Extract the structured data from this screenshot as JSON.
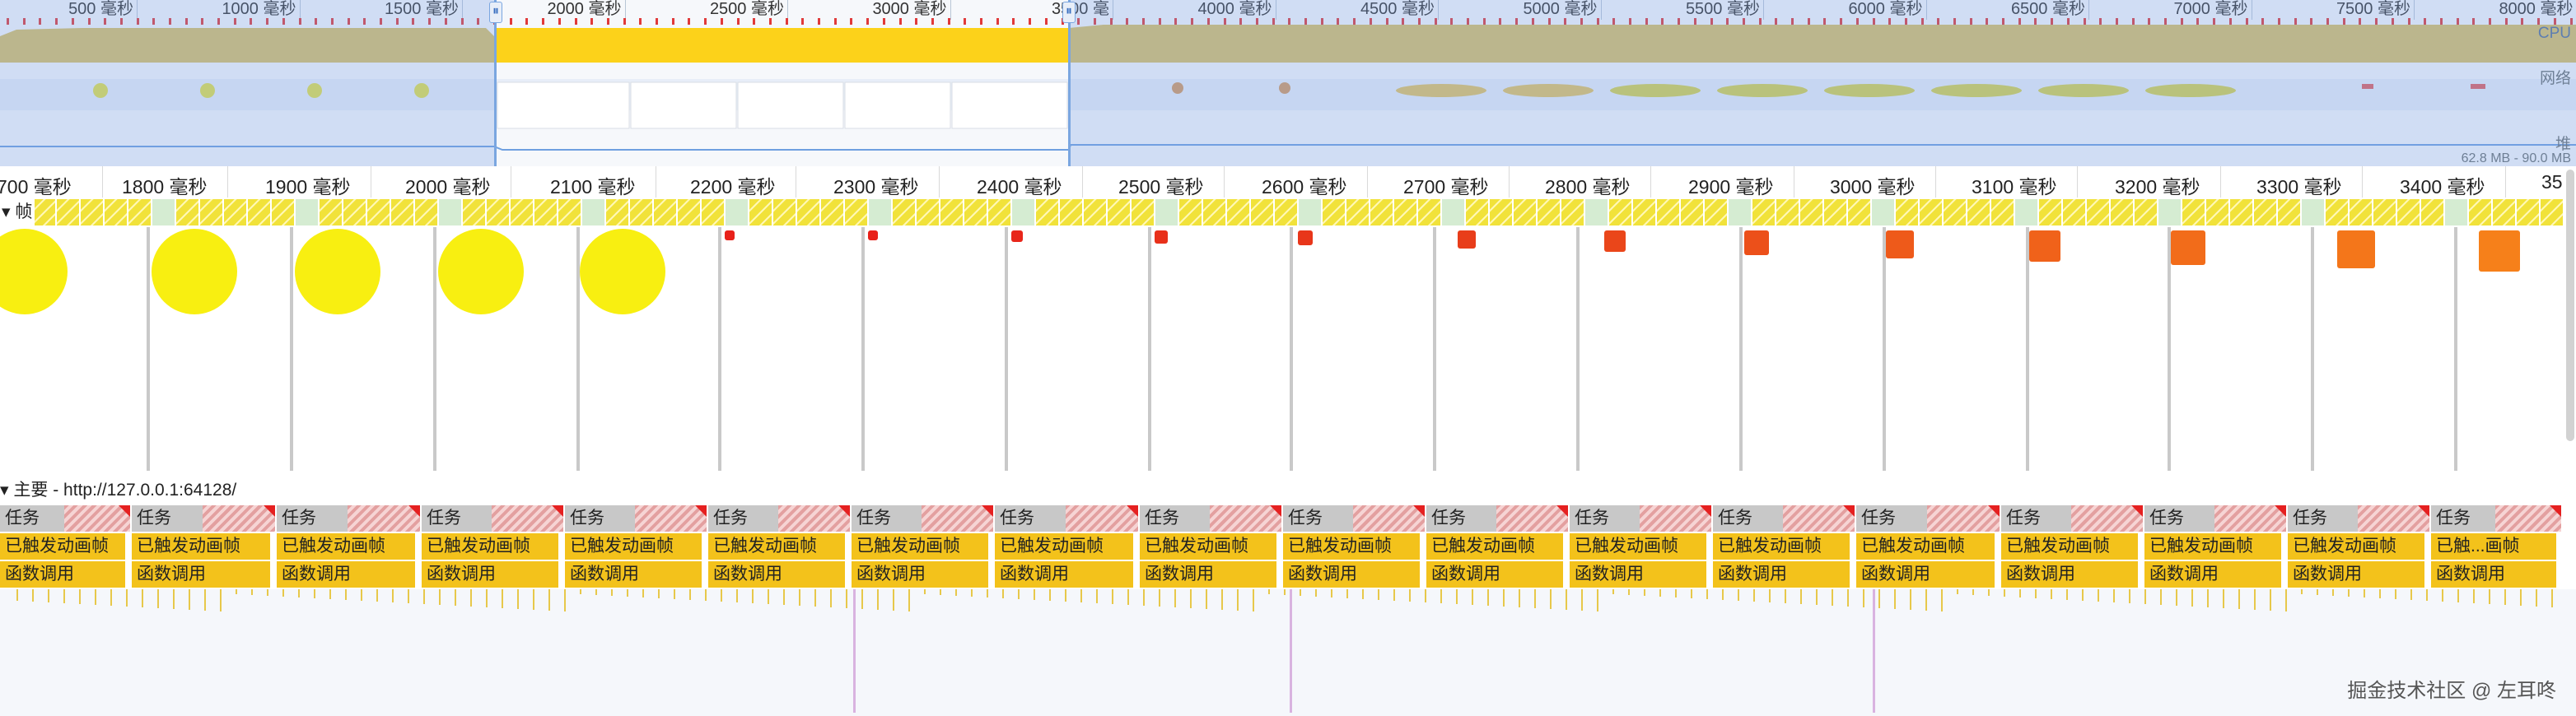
{
  "overview": {
    "ruler_labels": [
      "500 毫秒",
      "1000 毫秒",
      "1500 毫秒",
      "2000 毫秒",
      "2500 毫秒",
      "3000 毫秒",
      "3500 毫",
      "4000 毫秒",
      "4500 毫秒",
      "5000 毫秒",
      "5500 毫秒",
      "6000 毫秒",
      "6500 毫秒",
      "7000 毫秒",
      "7500 毫秒",
      "8000 毫秒"
    ],
    "lanes": {
      "cpu": "CPU",
      "network": "网络",
      "heap": "堆",
      "heap_range": "62.8 MB - 90.0 MB"
    }
  },
  "ruler": {
    "labels": [
      "700 毫秒",
      "1800 毫秒",
      "1900 毫秒",
      "2000 毫秒",
      "2100 毫秒",
      "2200 毫秒",
      "2300 毫秒",
      "2400 毫秒",
      "2500 毫秒",
      "2600 毫秒",
      "2700 毫秒",
      "2800 毫秒",
      "2900 毫秒",
      "3000 毫秒",
      "3100 毫秒",
      "3200 毫秒",
      "3300 毫秒",
      "3400 毫秒",
      "35"
    ]
  },
  "frames": {
    "title": "帧"
  },
  "main_thread": {
    "header": "主要 - http://127.0.0.1:64128/",
    "task_label": "任务",
    "anim_label": "已触发动画帧",
    "anim_label_truncated": "已触...画帧",
    "func_label": "函数调用"
  },
  "watermark": "掘金技术社区 @ 左耳咚",
  "colors": {
    "cpu": "#d9c168",
    "selection": "#fcd21a",
    "task": "#c8c8c8",
    "anim": "#f3c21b",
    "long_task": "#e52020"
  }
}
